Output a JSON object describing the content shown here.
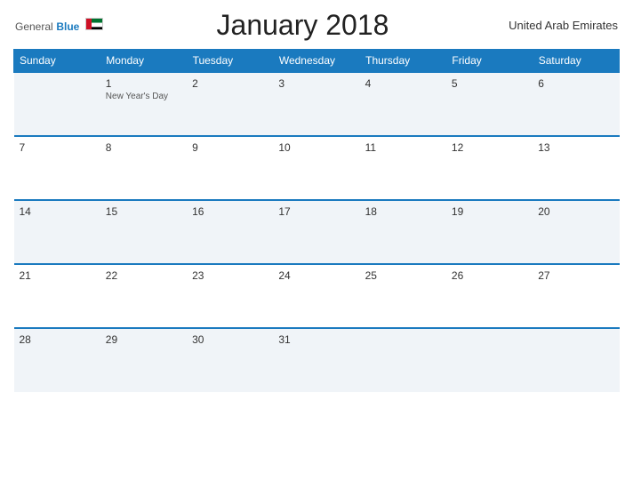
{
  "header": {
    "logo_general": "General",
    "logo_blue": "Blue",
    "title": "January 2018",
    "country": "United Arab Emirates"
  },
  "weekdays": [
    "Sunday",
    "Monday",
    "Tuesday",
    "Wednesday",
    "Thursday",
    "Friday",
    "Saturday"
  ],
  "weeks": [
    [
      {
        "day": "",
        "holiday": ""
      },
      {
        "day": "1",
        "holiday": "New Year's Day"
      },
      {
        "day": "2",
        "holiday": ""
      },
      {
        "day": "3",
        "holiday": ""
      },
      {
        "day": "4",
        "holiday": ""
      },
      {
        "day": "5",
        "holiday": ""
      },
      {
        "day": "6",
        "holiday": ""
      }
    ],
    [
      {
        "day": "7",
        "holiday": ""
      },
      {
        "day": "8",
        "holiday": ""
      },
      {
        "day": "9",
        "holiday": ""
      },
      {
        "day": "10",
        "holiday": ""
      },
      {
        "day": "11",
        "holiday": ""
      },
      {
        "day": "12",
        "holiday": ""
      },
      {
        "day": "13",
        "holiday": ""
      }
    ],
    [
      {
        "day": "14",
        "holiday": ""
      },
      {
        "day": "15",
        "holiday": ""
      },
      {
        "day": "16",
        "holiday": ""
      },
      {
        "day": "17",
        "holiday": ""
      },
      {
        "day": "18",
        "holiday": ""
      },
      {
        "day": "19",
        "holiday": ""
      },
      {
        "day": "20",
        "holiday": ""
      }
    ],
    [
      {
        "day": "21",
        "holiday": ""
      },
      {
        "day": "22",
        "holiday": ""
      },
      {
        "day": "23",
        "holiday": ""
      },
      {
        "day": "24",
        "holiday": ""
      },
      {
        "day": "25",
        "holiday": ""
      },
      {
        "day": "26",
        "holiday": ""
      },
      {
        "day": "27",
        "holiday": ""
      }
    ],
    [
      {
        "day": "28",
        "holiday": ""
      },
      {
        "day": "29",
        "holiday": ""
      },
      {
        "day": "30",
        "holiday": ""
      },
      {
        "day": "31",
        "holiday": ""
      },
      {
        "day": "",
        "holiday": ""
      },
      {
        "day": "",
        "holiday": ""
      },
      {
        "day": "",
        "holiday": ""
      }
    ]
  ]
}
